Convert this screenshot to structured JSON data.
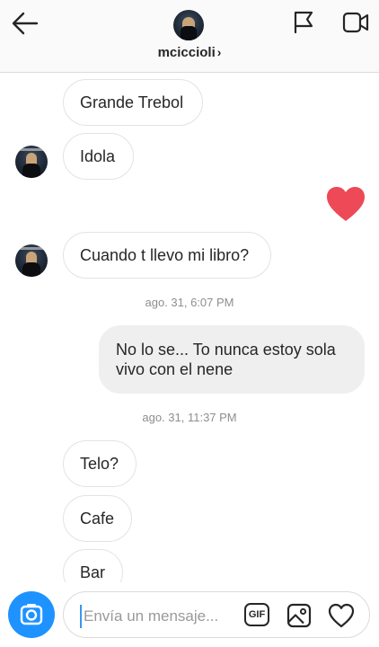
{
  "header": {
    "username": "mciccioli",
    "chevron": "›",
    "icons": {
      "back": "arrow-left-icon",
      "flag": "flag-icon",
      "video": "video-camera-icon"
    }
  },
  "conversation": {
    "received_1": "Grande Trebol",
    "received_2": "Idola",
    "sent_reaction": "heart-icon",
    "received_3": "Cuando t llevo mi libro?",
    "timestamp_1": "ago. 31, 6:07 PM",
    "sent_1": "No lo se... To nunca estoy sola vivo con el nene",
    "timestamp_2": "ago. 31, 11:37 PM",
    "received_4": "Telo?",
    "received_5": "Cafe",
    "received_6": "Bar"
  },
  "composer": {
    "placeholder": "Envía un mensaje...",
    "gif_label": "GIF",
    "icons": {
      "camera": "camera-icon",
      "gallery": "image-icon",
      "like": "heart-outline-icon"
    }
  },
  "colors": {
    "accent_blue": "#1e93ff",
    "heart_red": "#ed4956",
    "sent_bubble": "#efefef",
    "timestamp_gray": "#8e8e8e"
  }
}
